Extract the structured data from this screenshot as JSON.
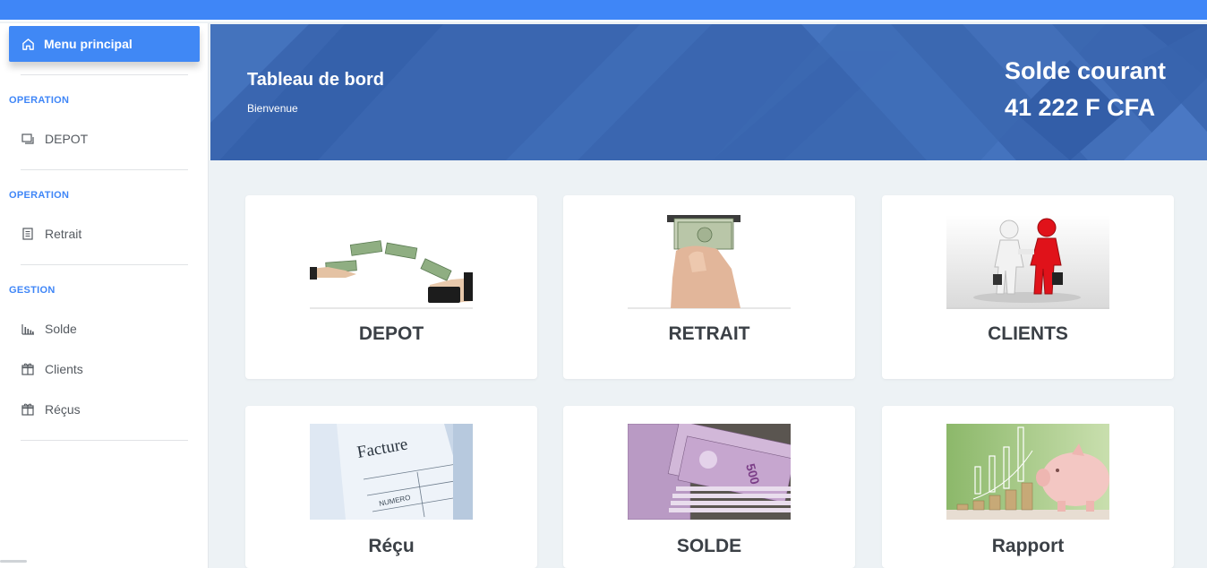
{
  "sidebar": {
    "menu_main": "Menu principal",
    "sections": [
      {
        "heading": "OPERATION",
        "items": [
          {
            "label": "DEPOT",
            "icon": "depot-icon"
          }
        ]
      },
      {
        "heading": "OPERATION",
        "items": [
          {
            "label": "Retrait",
            "icon": "receipt-icon"
          }
        ]
      },
      {
        "heading": "GESTION",
        "items": [
          {
            "label": "Solde",
            "icon": "bar-chart-icon"
          },
          {
            "label": "Clients",
            "icon": "gift-icon"
          },
          {
            "label": "Réçus",
            "icon": "gift-icon"
          }
        ]
      }
    ]
  },
  "header": {
    "title": "Tableau de bord",
    "subtitle": "Bienvenue",
    "balance_label": "Solde courant",
    "balance_value": "41 222 F CFA"
  },
  "cards": [
    {
      "label": "DEPOT",
      "image": "money-transfer-image"
    },
    {
      "label": "RETRAIT",
      "image": "atm-cash-image"
    },
    {
      "label": "CLIENTS",
      "image": "handshake-image"
    },
    {
      "label": "Réçu",
      "image": "invoice-image"
    },
    {
      "label": "SOLDE",
      "image": "banknotes-image"
    },
    {
      "label": "Rapport",
      "image": "piggy-bank-image"
    }
  ],
  "colors": {
    "accent": "#3f86f7",
    "header_bg": "#3a66b0",
    "page_bg": "#edf2f5",
    "card_text": "#3b4046"
  }
}
